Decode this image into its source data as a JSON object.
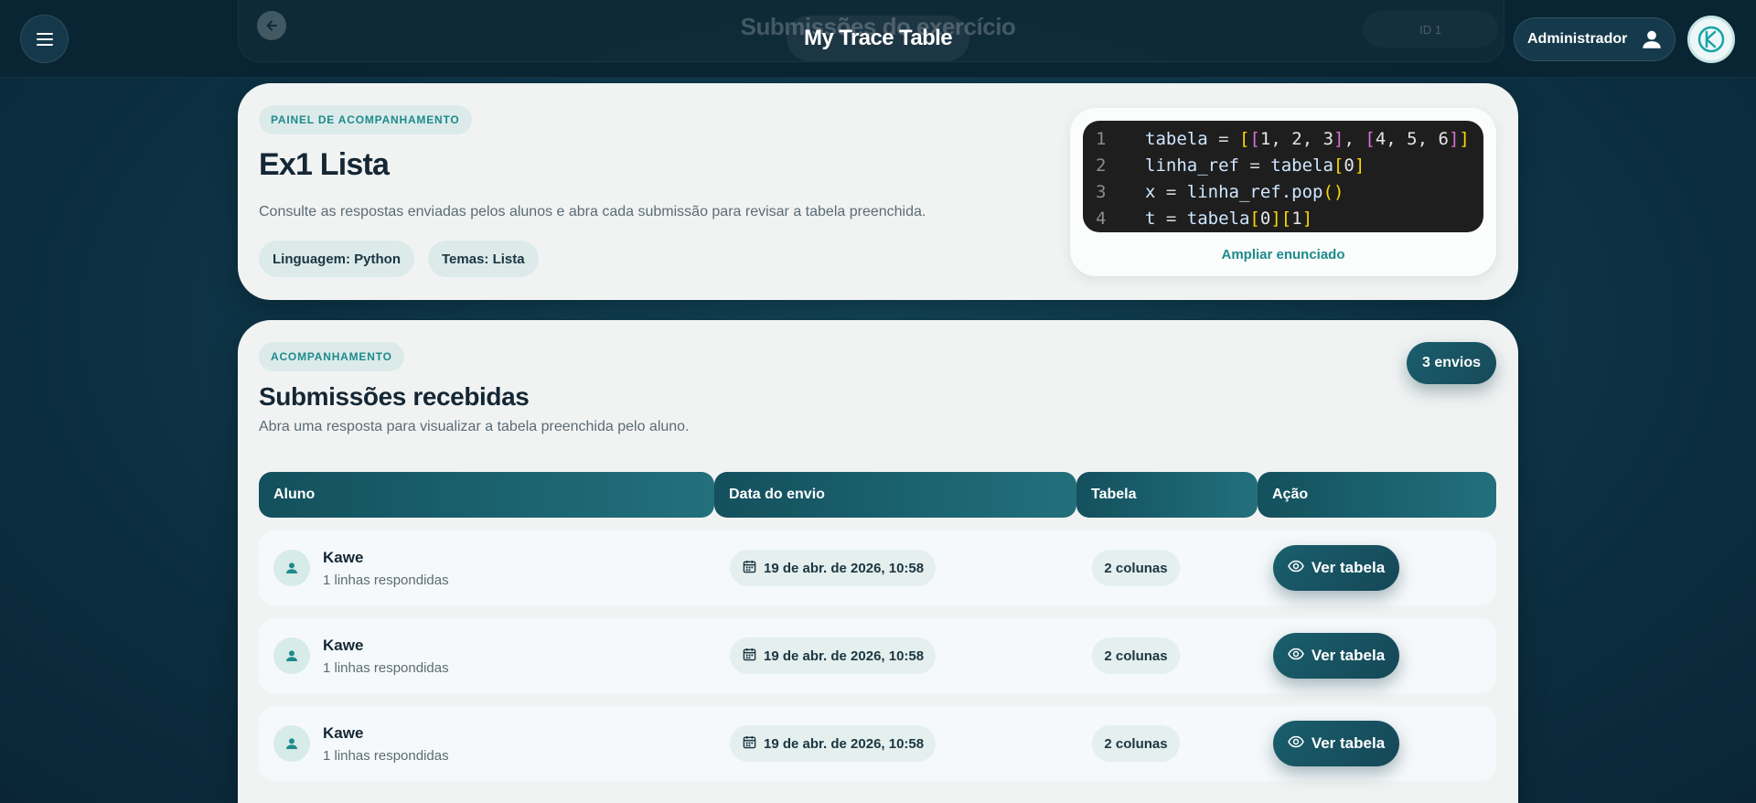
{
  "app": {
    "brand": "My Trace Table",
    "background_title": "Submissões do exercício",
    "background_id": "ID 1",
    "user_label": "Administrador"
  },
  "icons": {
    "menu": "menu-icon",
    "back": "arrow-left-icon",
    "user": "user-icon",
    "logo": "logo-icon",
    "calendar": "calendar-icon",
    "eye": "eye-icon",
    "avatar": "person-icon"
  },
  "colors": {
    "accent": "#1e8a8c",
    "primary_dark": "#17495a",
    "background": "#0f3b4e"
  },
  "exercise": {
    "eyebrow": "PAINEL DE ACOMPANHAMENTO",
    "title": "Ex1 Lista",
    "description": "Consulte as respostas enviadas pelos alunos e abra cada submissão para revisar a tabela preenchida.",
    "language_tag": "Linguagem: Python",
    "themes_tag": "Temas: Lista",
    "expand_label": "Ampliar enunciado",
    "code_lines": [
      {
        "n": "1",
        "text": "tabela = [[1, 2, 3], [4, 5, 6]]"
      },
      {
        "n": "2",
        "text": "linha_ref = tabela[0]"
      },
      {
        "n": "3",
        "text": "x = linha_ref.pop()"
      },
      {
        "n": "4",
        "text": "t = tabela[0][1]"
      }
    ]
  },
  "submissions": {
    "eyebrow": "ACOMPANHAMENTO",
    "title": "Submissões recebidas",
    "subtitle": "Abra uma resposta para visualizar a tabela preenchida pelo aluno.",
    "count_label": "3 envios",
    "columns": [
      "Aluno",
      "Data do envio",
      "Tabela",
      "Ação"
    ],
    "rows": [
      {
        "name": "Kawe",
        "lines": "1 linhas respondidas",
        "date": "19 de abr. de 2026, 10:58",
        "columns": "2 colunas",
        "action": "Ver tabela"
      },
      {
        "name": "Kawe",
        "lines": "1 linhas respondidas",
        "date": "19 de abr. de 2026, 10:58",
        "columns": "2 colunas",
        "action": "Ver tabela"
      },
      {
        "name": "Kawe",
        "lines": "1 linhas respondidas",
        "date": "19 de abr. de 2026, 10:58",
        "columns": "2 colunas",
        "action": "Ver tabela"
      }
    ]
  }
}
